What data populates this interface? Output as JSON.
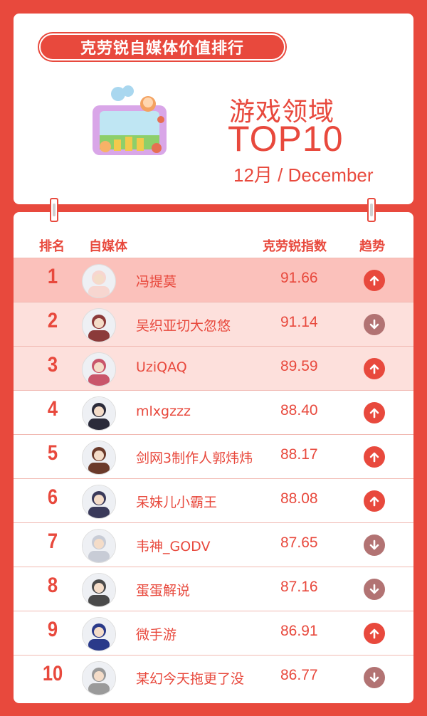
{
  "header": {
    "title": "克劳锐自媒体价值排行",
    "domain": "游戏领域",
    "top": "TOP10",
    "month": "12月 / December"
  },
  "columns": {
    "rank": "排名",
    "media": "自媒体",
    "index": "克劳锐指数",
    "trend": "趋势"
  },
  "colors": {
    "brand": "#e8493d",
    "up": "#e8493d",
    "down": "#b27373",
    "highlight_strong": "#fbc1bb",
    "highlight_light": "#fde0dc"
  },
  "rows": [
    {
      "rank": "1",
      "name": "冯提莫",
      "score": "91.66",
      "trend": "up"
    },
    {
      "rank": "2",
      "name": "吴织亚切大忽悠",
      "score": "91.14",
      "trend": "down"
    },
    {
      "rank": "3",
      "name": "UziQAQ",
      "score": "89.59",
      "trend": "up"
    },
    {
      "rank": "4",
      "name": "mlxgzzz",
      "score": "88.40",
      "trend": "up"
    },
    {
      "rank": "5",
      "name": "剑网3制作人郭炜炜",
      "score": "88.17",
      "trend": "up"
    },
    {
      "rank": "6",
      "name": "呆妹儿小霸王",
      "score": "88.08",
      "trend": "up"
    },
    {
      "rank": "7",
      "name": "韦神_GODV",
      "score": "87.65",
      "trend": "down"
    },
    {
      "rank": "8",
      "name": "蛋蛋解说",
      "score": "87.16",
      "trend": "down"
    },
    {
      "rank": "9",
      "name": "微手游",
      "score": "86.91",
      "trend": "up"
    },
    {
      "rank": "10",
      "name": "某幻今天拖更了没",
      "score": "86.77",
      "trend": "down"
    }
  ]
}
